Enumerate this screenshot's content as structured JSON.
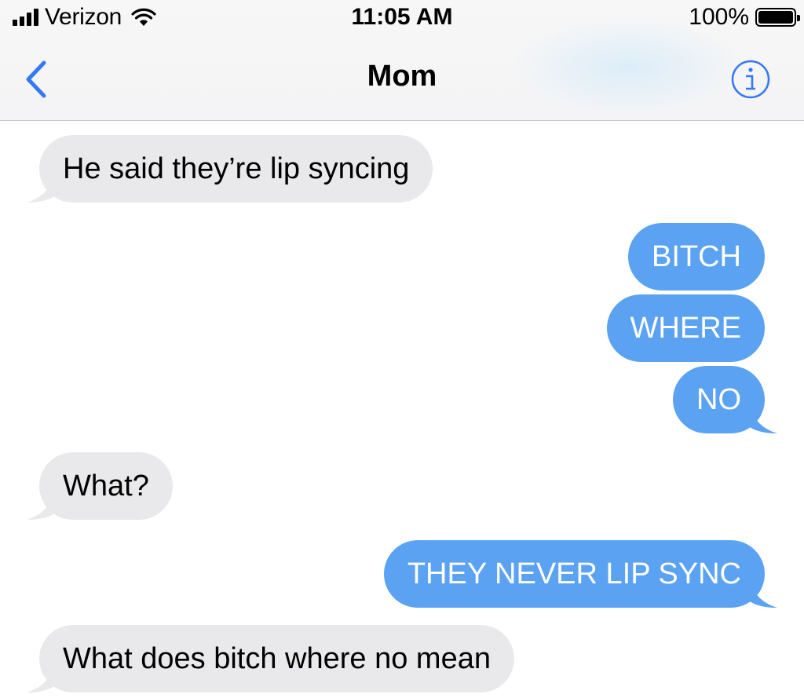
{
  "status_bar": {
    "carrier": "Verizon",
    "time": "11:05 AM",
    "battery": "100%"
  },
  "nav": {
    "title": "Mom",
    "back_icon": "chevron-left-icon",
    "info_icon": "info-icon"
  },
  "messages": [
    {
      "from": "them",
      "text": "He said they’re lip syncing"
    },
    {
      "from": "me",
      "text": "BITCH"
    },
    {
      "from": "me",
      "text": "WHERE"
    },
    {
      "from": "me",
      "text": "NO"
    },
    {
      "from": "them",
      "text": "What?"
    },
    {
      "from": "me",
      "text": "THEY NEVER LIP SYNC"
    },
    {
      "from": "them",
      "text": "What does bitch where no mean"
    }
  ],
  "colors": {
    "sent_bubble": "#5ba3f2",
    "received_bubble": "#e9e9eb",
    "accent": "#3478f6"
  }
}
